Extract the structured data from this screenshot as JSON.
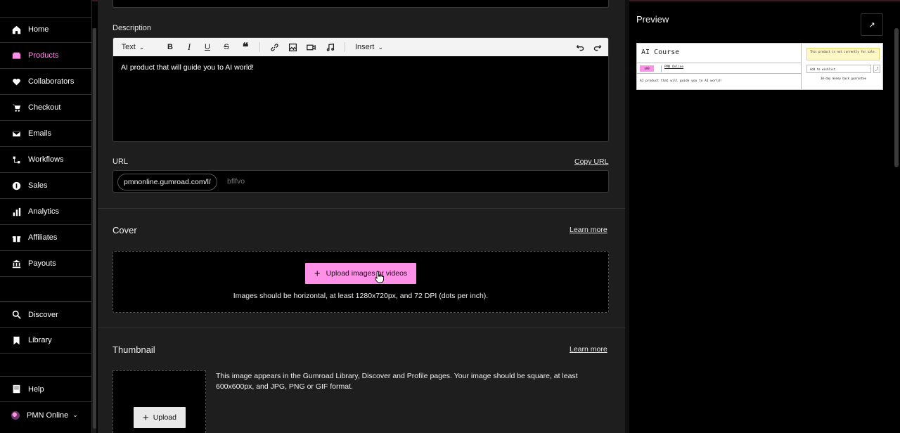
{
  "sidebar": {
    "items": [
      {
        "label": "Home",
        "icon": "home-icon"
      },
      {
        "label": "Products",
        "icon": "products-icon",
        "active": true
      },
      {
        "label": "Collaborators",
        "icon": "collaborators-icon"
      },
      {
        "label": "Checkout",
        "icon": "cart-icon"
      },
      {
        "label": "Emails",
        "icon": "mail-icon"
      },
      {
        "label": "Workflows",
        "icon": "workflow-icon"
      },
      {
        "label": "Sales",
        "icon": "dollar-icon"
      },
      {
        "label": "Analytics",
        "icon": "bar-chart-icon"
      },
      {
        "label": "Affiliates",
        "icon": "gift-icon"
      },
      {
        "label": "Payouts",
        "icon": "bank-icon"
      }
    ],
    "bottom_items": [
      {
        "label": "Discover",
        "icon": "search-icon"
      },
      {
        "label": "Library",
        "icon": "bookmark-icon"
      },
      {
        "label": "Help",
        "icon": "book-icon"
      }
    ],
    "account": {
      "label": "PMN Online"
    },
    "accent_color": "#ff90e8"
  },
  "description": {
    "label": "Description",
    "toolbar": {
      "text_style": "Text",
      "insert": "Insert",
      "buttons": [
        "bold-icon",
        "italic-icon",
        "underline-icon",
        "strikethrough-icon",
        "quote-icon",
        "link-icon",
        "image-icon",
        "video-icon",
        "music-icon",
        "undo-icon",
        "redo-icon"
      ]
    },
    "content": "AI product that will guide you to AI world!"
  },
  "url": {
    "label": "URL",
    "copy_label": "Copy URL",
    "prefix": "pmnonline.gumroad.com/l/",
    "slug": "bflfvo"
  },
  "cover": {
    "title": "Cover",
    "learn_more": "Learn more",
    "upload_label": "Upload images or videos",
    "hint": "Images should be horizontal, at least 1280x720px, and 72 DPI (dots per inch)."
  },
  "thumbnail": {
    "title": "Thumbnail",
    "learn_more": "Learn more",
    "upload_label": "Upload",
    "description": "This image appears in the Gumroad Library, Discover and Profile pages. Your image should be square, at least 600x600px, and JPG, PNG or GIF format."
  },
  "preview": {
    "title": "Preview",
    "product_title": "AI Course",
    "price": "$99",
    "seller": "PMN Online",
    "description": "AI product that will guide you to AI world!",
    "notice": "This product is not currently for sale.",
    "wishlist": "Add to wishlist",
    "guarantee": "30-day money back guarantee"
  }
}
